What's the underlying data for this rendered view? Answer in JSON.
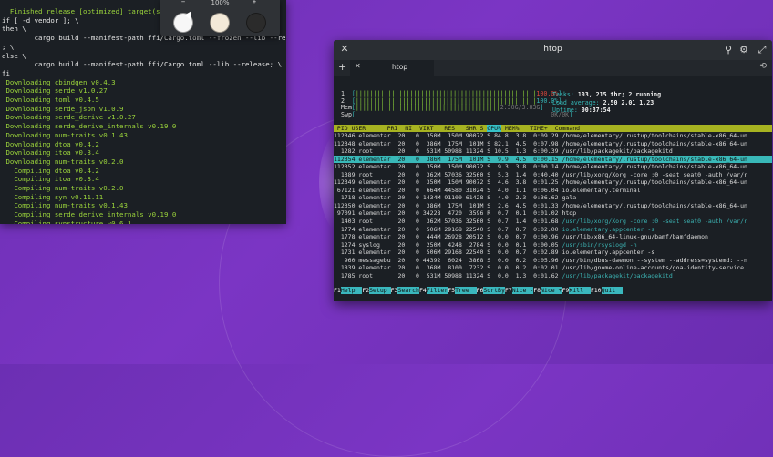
{
  "terminal_left": {
    "lines": [
      {
        "t": "  Finished release [optimized] target(s)",
        "g": true
      },
      {
        "t": "if [ -d vendor ]; \\",
        "g": false
      },
      {
        "t": "then \\",
        "g": false
      },
      {
        "t": "        cargo build --manifest-path ffi/Cargo.toml --frozen --lib --release \\",
        "g": false
      },
      {
        "t": "; \\",
        "g": false
      },
      {
        "t": "else \\",
        "g": false
      },
      {
        "t": "        cargo build --manifest-path ffi/Cargo.toml --lib --release; \\",
        "g": false
      },
      {
        "t": "fi",
        "g": false
      },
      {
        "t": " Downloading cbindgen v0.4.3",
        "g": true
      },
      {
        "t": " Downloading serde v1.0.27",
        "g": true
      },
      {
        "t": " Downloading toml v0.4.5",
        "g": true
      },
      {
        "t": " Downloading serde_json v1.0.9",
        "g": true
      },
      {
        "t": " Downloading serde_derive v1.0.27",
        "g": true
      },
      {
        "t": " Downloading serde_derive_internals v0.19.0",
        "g": true
      },
      {
        "t": " Downloading num-traits v0.1.43",
        "g": true
      },
      {
        "t": " Downloading dtoa v0.4.2",
        "g": true
      },
      {
        "t": " Downloading itoa v0.3.4",
        "g": true
      },
      {
        "t": " Downloading num-traits v0.2.0",
        "g": true
      },
      {
        "t": "   Compiling dtoa v0.4.2",
        "g": true
      },
      {
        "t": "   Compiling itoa v0.3.4",
        "g": true
      },
      {
        "t": "   Compiling num-traits v0.2.0",
        "g": true
      },
      {
        "t": "   Compiling syn v0.11.11",
        "g": true
      },
      {
        "t": "   Compiling num-traits v0.1.43",
        "g": true
      },
      {
        "t": "   Compiling serde_derive_internals v0.19.0",
        "g": true
      },
      {
        "t": "   Compiling synstructure v0.6.1",
        "g": true
      }
    ]
  },
  "zoom_popup": {
    "zoom_level": "100%",
    "zoom_out": "−",
    "zoom_in": "+",
    "swatches": [
      "#f7f7f7",
      "#f3e9d8",
      "#2b2b2b"
    ]
  },
  "htop_window": {
    "title": "htop",
    "tab_label": "htop",
    "meters": {
      "cpu1_label": "1",
      "cpu1_val": "100.0%",
      "cpu2_label": "2",
      "cpu2_val": "100.0%",
      "mem_label": "Mem",
      "mem_val": "2.30G/3.83G",
      "swp_label": "Swp",
      "swp_val": "0K/0K"
    },
    "stats": {
      "tasks_label": "Tasks:",
      "tasks_val": "103, 215 thr; 2 running",
      "load_label": "Load average:",
      "load_val": "2.50 2.01 1.23",
      "uptime_label": "Uptime:",
      "uptime_val": "00:37:54"
    },
    "header": " PID USER      PRI  NI  VIRT   RES   SHR S ",
    "header_sort": "CPU%",
    "header_tail": " MEM%   TIME+  Command",
    "processes": [
      {
        "l": "112346 elementar  20   0  350M  150M 90072 S 84.8  3.8  0:09.29 ",
        "cmd": "/home/elementary/.rustup/toolchains/stable-x86_64-un",
        "c2": false,
        "sel": false
      },
      {
        "l": "112348 elementar  20   0  386M  175M  101M S 82.1  4.5  0:07.98 ",
        "cmd": "/home/elementary/.rustup/toolchains/stable-x86_64-un",
        "c2": false,
        "sel": false
      },
      {
        "l": "  1282 root       20   0  531M 50988 11324 S 10.5  1.3  6:00.39 ",
        "cmd": "/usr/lib/packagekit/packagekitd",
        "c2": false,
        "sel": false
      },
      {
        "l": "112354 elementar  20   0  386M  175M  101M S  9.9  4.5  0:00.15 ",
        "cmd": "/home/elementary/.rustup/toolchains/stable-x86_64-un",
        "c2": false,
        "sel": true
      },
      {
        "l": "112352 elementar  20   0  350M  150M 90072 S  9.3  3.8  0:00.14 ",
        "cmd": "/home/elementary/.rustup/toolchains/stable-x86_64-un",
        "c2": false,
        "sel": false
      },
      {
        "l": "  1389 root       20   0  362M 57036 32560 S  5.3  1.4  0:40.40 ",
        "cmd": "/usr/lib/xorg/Xorg -core :0 -seat seat0 -auth /var/r",
        "c2": false,
        "sel": false
      },
      {
        "l": "112349 elementar  20   0  350M  150M 90072 S  4.6  3.8  0:01.25 ",
        "cmd": "/home/elementary/.rustup/toolchains/stable-x86_64-un",
        "c2": false,
        "sel": false
      },
      {
        "l": " 67121 elementar  20   0  664M 44580 31024 S  4.0  1.1  0:06.04 ",
        "cmd": "io.elementary.terminal",
        "c2": false,
        "sel": false
      },
      {
        "l": "  1718 elementar  20   0 1434M 91100 61428 S  4.0  2.3  0:36.62 ",
        "cmd": "gala",
        "c2": false,
        "sel": false
      },
      {
        "l": "112350 elementar  20   0  386M  175M  101M S  2.6  4.5  0:01.33 ",
        "cmd": "/home/elementary/.rustup/toolchains/stable-x86_64-un",
        "c2": false,
        "sel": false
      },
      {
        "l": " 97091 elementar  20   0 34228  4720  3596 R  0.7  0.1  0:01.02 ",
        "cmd": "htop",
        "c2": false,
        "sel": false
      },
      {
        "l": "  1403 root       20   0  362M 57036 32560 S  0.7  1.4  0:01.68 ",
        "cmd": "/usr/lib/xorg/Xorg -core :0 -seat seat0 -auth /var/r",
        "c2": true,
        "sel": false
      },
      {
        "l": "  1774 elementar  20   0  506M 29168 22540 S  0.7  0.7  0:02.00 ",
        "cmd": "io.elementary.appcenter -s",
        "c2": true,
        "sel": false
      },
      {
        "l": "  1778 elementar  20   0  444M 26928 20512 S  0.0  0.7  0:00.96 ",
        "cmd": "/usr/lib/x86_64-linux-gnu/bamf/bamfdaemon",
        "c2": false,
        "sel": false
      },
      {
        "l": "  1274 syslog     20   0  250M  4248  2784 S  0.0  0.1  0:00.05 ",
        "cmd": "/usr/sbin/rsyslogd -n",
        "c2": true,
        "sel": false
      },
      {
        "l": "  1731 elementar  20   0  506M 29168 22540 S  0.0  0.7  0:02.89 ",
        "cmd": "io.elementary.appcenter -s",
        "c2": false,
        "sel": false
      },
      {
        "l": "   960 messagebu  20   0 44392  6024  3868 S  0.0  0.2  0:05.96 ",
        "cmd": "/usr/bin/dbus-daemon --system --address=systemd: --n",
        "c2": false,
        "sel": false
      },
      {
        "l": "  1839 elementar  20   0  368M  8100  7232 S  0.0  0.2  0:02.01 ",
        "cmd": "/usr/lib/gnome-online-accounts/goa-identity-service",
        "c2": false,
        "sel": false
      },
      {
        "l": "  1785 root       20   0  531M 50988 11324 S  0.0  1.3  0:01.62 ",
        "cmd": "/usr/lib/packagekit/packagekitd",
        "c2": true,
        "sel": false
      }
    ],
    "function_keys": [
      {
        "k": "F1",
        "l": "Help  "
      },
      {
        "k": "F2",
        "l": "Setup "
      },
      {
        "k": "F3",
        "l": "Search"
      },
      {
        "k": "F4",
        "l": "Filter"
      },
      {
        "k": "F5",
        "l": "Tree  "
      },
      {
        "k": "F6",
        "l": "SortBy"
      },
      {
        "k": "F7",
        "l": "Nice -"
      },
      {
        "k": "F8",
        "l": "Nice +"
      },
      {
        "k": "F9",
        "l": "Kill  "
      },
      {
        "k": "F10",
        "l": "Quit  "
      }
    ]
  },
  "icons": {
    "close": "close-icon",
    "search": "search-icon",
    "settings": "gear-icon",
    "maximize": "maximize-icon",
    "history": "history-icon",
    "add_tab": "plus-icon"
  }
}
